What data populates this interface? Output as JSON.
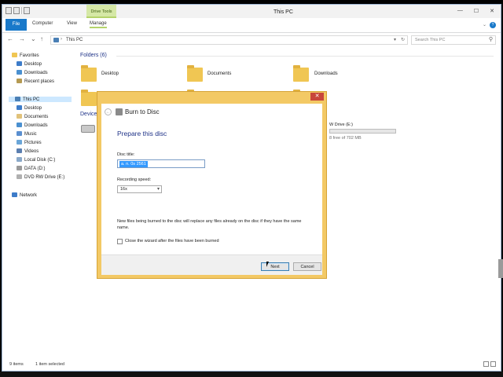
{
  "window": {
    "title": "This PC",
    "context_tab": "Drive Tools",
    "controls": [
      "—",
      "☐",
      "✕"
    ]
  },
  "ribbon": {
    "tabs": [
      "File",
      "Computer",
      "View",
      "Manage"
    ],
    "expand": "⌄",
    "help": "?"
  },
  "address": {
    "path": "This PC",
    "chevron": "›",
    "dropdown": "▾",
    "refresh": "↻",
    "search_placeholder": "Search This PC"
  },
  "nav_buttons": [
    "←",
    "→",
    "⌄",
    "↑"
  ],
  "sidebar": {
    "favorites_label": "Favorites",
    "favorites": [
      "Desktop",
      "Downloads",
      "Recent places"
    ],
    "this_pc_label": "This PC",
    "this_pc_items": [
      "Desktop",
      "Documents",
      "Downloads",
      "Music",
      "Pictures",
      "Videos",
      "Local Disk (C:)",
      "DATA (D:)",
      "DVD RW Drive (E:)"
    ],
    "network_label": "Network"
  },
  "content": {
    "folders_header": "Folders (6)",
    "folders": [
      "Desktop",
      "Documents",
      "Downloads"
    ],
    "devices_header_partial": "Device",
    "drive": {
      "name": "DVD RW Drive (E:)",
      "name_visible": "W Drive (E:)",
      "space_visible": "8 free of 702 MB",
      "free_fraction": 0.0
    }
  },
  "status": {
    "items": "9 items",
    "selected": "1 item selected"
  },
  "dialog": {
    "title": "Burn to Disc",
    "heading": "Prepare this disc",
    "disc_title_label": "Disc title:",
    "disc_title_value": "a. n. 0s 2561",
    "speed_label": "Recording speed:",
    "speed_value": "16x",
    "note": "New files being burned to the disc will replace any files already on the disc if they have the same name.",
    "checkbox_label": "Close the wizard after the files have been burned",
    "checkbox_checked": false,
    "next_label": "Next",
    "cancel_label": "Cancel",
    "close_glyph": "✕",
    "back_glyph": "←"
  },
  "colors": {
    "dialog_frame": "#f3c965",
    "file_tab": "#1979ca",
    "context_tab": "#d5e8a6",
    "heading_blue": "#1e3287",
    "selection": "#3399ff"
  }
}
